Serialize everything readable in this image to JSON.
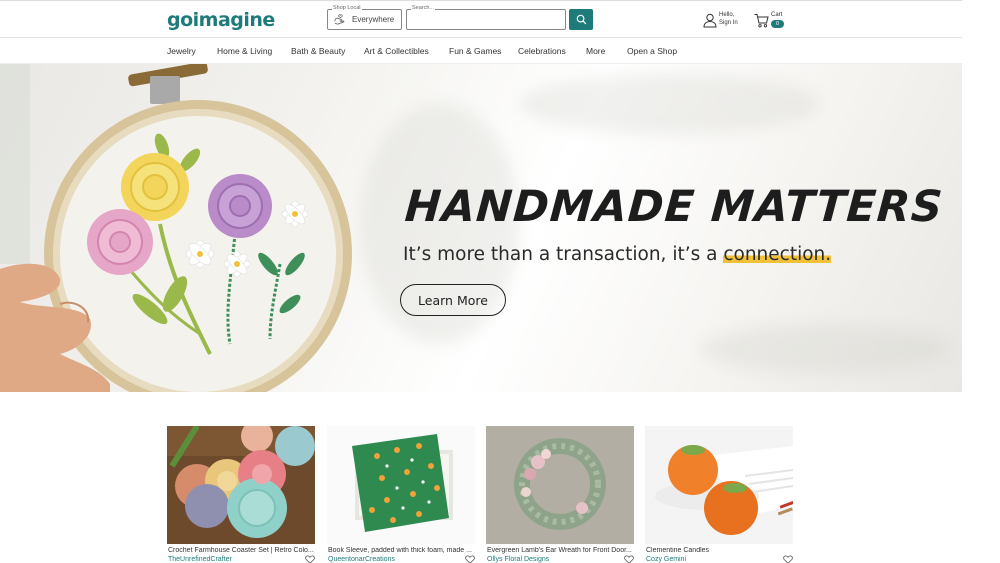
{
  "header": {
    "logo": {
      "part1": "go",
      "part2": "imagine"
    },
    "shop_local": {
      "label": "Shop Local",
      "value": "Everywhere"
    },
    "search": {
      "label": "Search...",
      "placeholder": ""
    },
    "user": {
      "hello": "Hello,",
      "signin": "Sign In"
    },
    "cart": {
      "label": "Cart",
      "count": "0"
    }
  },
  "nav": {
    "items": [
      "Jewelry",
      "Home & Living",
      "Bath & Beauty",
      "Art & Collectibles",
      "Fun & Games",
      "Celebrations",
      "More",
      "Open a Shop"
    ]
  },
  "hero": {
    "title": "HANDMADE MATTERS",
    "subtitle_prefix": "It’s more than a transaction, it’s a ",
    "subtitle_highlight": "connection.",
    "button": "Learn More"
  },
  "products": [
    {
      "title": "Crochet Farmhouse Coaster Set | Retro Colo...",
      "shop": "TheUnrefinedCrafter"
    },
    {
      "title": "Book Sleeve, padded with thick foam, made ...",
      "shop": "QueentonarCreations"
    },
    {
      "title": "Evergreen Lamb’s Ear Wreath for Front Door...",
      "shop": "Ollys Floral Designs"
    },
    {
      "title": "Clementine Candles",
      "shop": "Cozy Gemini"
    }
  ],
  "colors": {
    "brand": "#1f7a7a",
    "highlight": "#f2c13a"
  }
}
